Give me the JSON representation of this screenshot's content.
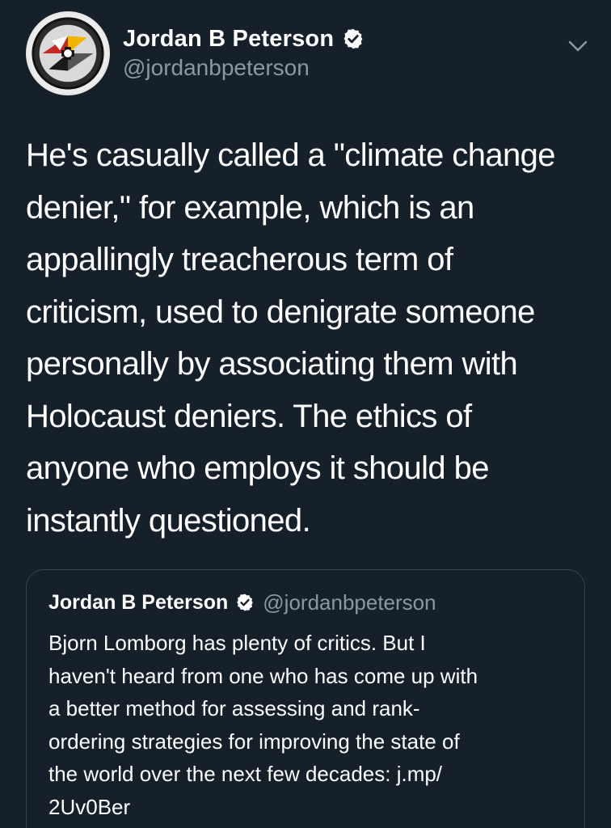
{
  "tweet": {
    "author": {
      "display_name": "Jordan B Peterson",
      "handle": "@jordanbpeterson",
      "verified": true
    },
    "text_lines": [
      "He's casually called a \"climate change",
      "denier,\" for example, which is an",
      "appallingly treacherous term of",
      "criticism, used to denigrate someone",
      "personally by associating them with",
      "Holocaust deniers. The ethics of",
      "anyone who employs it should be",
      "instantly questioned."
    ]
  },
  "quoted_tweet": {
    "author": {
      "display_name": "Jordan B Peterson",
      "handle": "@jordanbpeterson",
      "verified": true
    },
    "text_lines": [
      "Bjorn Lomborg has plenty of critics. But I",
      "haven't heard from one who has come up with",
      "a better method for assessing and rank-",
      "ordering strategies for improving the state of",
      "the world over the next few decades: j.mp/",
      "2Uv0Ber"
    ]
  },
  "colors": {
    "background": "#15202b",
    "text": "#ffffff",
    "secondary_text": "#8899a6",
    "verified": "#ffffff",
    "border": "#38444d"
  },
  "icons": {
    "verified": "verified-badge-icon",
    "menu": "chevron-down-icon"
  }
}
